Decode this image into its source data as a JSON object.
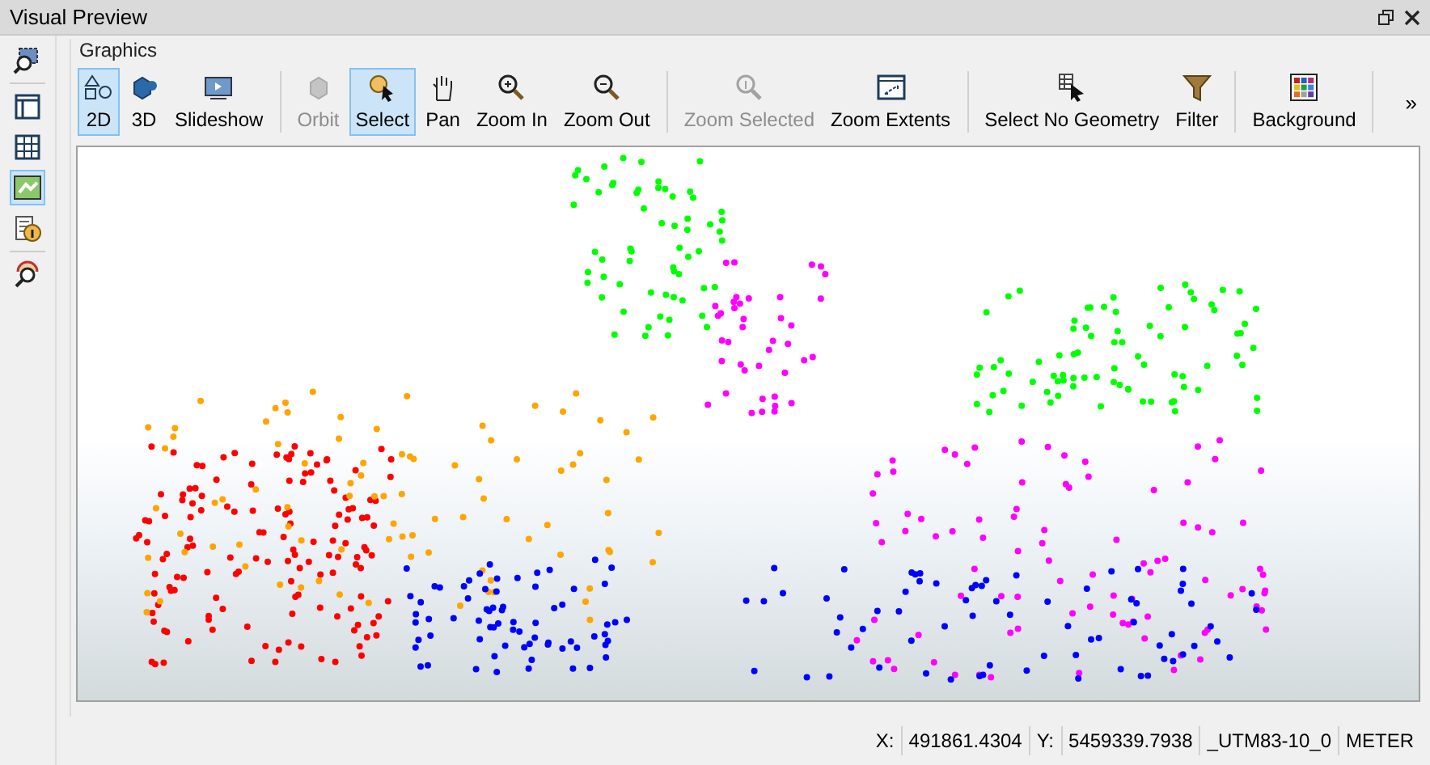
{
  "window": {
    "title": "Visual Preview"
  },
  "sidebar": {
    "items": [
      {
        "selected": false
      },
      {
        "selected": false
      },
      {
        "selected": false
      },
      {
        "selected": true
      },
      {
        "selected": false
      },
      {
        "selected": false
      }
    ]
  },
  "panel": {
    "title": "Graphics"
  },
  "toolbar": {
    "groups": [
      [
        {
          "label": "2D",
          "selected": true,
          "disabled": false
        },
        {
          "label": "3D",
          "selected": false,
          "disabled": false
        },
        {
          "label": "Slideshow",
          "selected": false,
          "disabled": false
        }
      ],
      [
        {
          "label": "Orbit",
          "selected": false,
          "disabled": true
        },
        {
          "label": "Select",
          "selected": true,
          "disabled": false
        },
        {
          "label": "Pan",
          "selected": false,
          "disabled": false
        },
        {
          "label": "Zoom In",
          "selected": false,
          "disabled": false
        },
        {
          "label": "Zoom Out",
          "selected": false,
          "disabled": false
        }
      ],
      [
        {
          "label": "Zoom Selected",
          "selected": false,
          "disabled": true
        },
        {
          "label": "Zoom Extents",
          "selected": false,
          "disabled": false
        }
      ],
      [
        {
          "label": "Select No Geometry",
          "selected": false,
          "disabled": false
        },
        {
          "label": "Filter",
          "selected": false,
          "disabled": false
        }
      ],
      [
        {
          "label": "Background",
          "selected": false,
          "disabled": false
        }
      ]
    ],
    "overflow": "»"
  },
  "status_bar": {
    "x_label": "X:",
    "x_value": "491861.4304",
    "y_label": "Y:",
    "y_value": "5459339.7938",
    "crs": "_UTM83-10_0",
    "unit": "METER"
  }
}
